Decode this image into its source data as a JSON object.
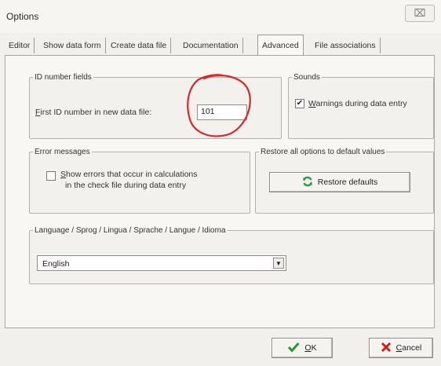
{
  "window": {
    "title": "Options",
    "close_label": "⌧"
  },
  "tabs": [
    {
      "label": "Editor"
    },
    {
      "label": "Show data form"
    },
    {
      "label": "Create data file"
    },
    {
      "label": "Documentation"
    },
    {
      "label": "Advanced",
      "active": true
    },
    {
      "label": "File associations"
    }
  ],
  "id_number_fields": {
    "legend": "ID number fields",
    "first_id_label_hotkey": "F",
    "first_id_label_rest": "irst ID number in new data file:",
    "first_id_value": "101"
  },
  "sounds": {
    "legend": "Sounds",
    "warnings_checked": true,
    "warnings_label_hotkey": "W",
    "warnings_label_rest": "arnings during data entry"
  },
  "error_messages": {
    "legend": "Error messages",
    "show_errors_checked": false,
    "show_errors_hotkey": "S",
    "show_errors_line1_rest": "how errors that occur in calculations",
    "show_errors_line2": "in the check file during data entry"
  },
  "restore": {
    "legend": "Restore all options to default values",
    "button_label": "Restore defaults",
    "icon": "refresh-icon"
  },
  "language": {
    "legend": "Language / Sprog / Lingua / Sprache / Langue / Idioma",
    "selected": "English"
  },
  "footer": {
    "ok_hotkey": "O",
    "ok_rest": "K",
    "cancel_hotkey": "C",
    "cancel_rest": "ancel"
  },
  "colors": {
    "annotation_red": "#d42a2a",
    "ok_check_green": "#2a9a2a",
    "cancel_x_red": "#cc1f1f",
    "refresh_green": "#2c9a3c"
  }
}
